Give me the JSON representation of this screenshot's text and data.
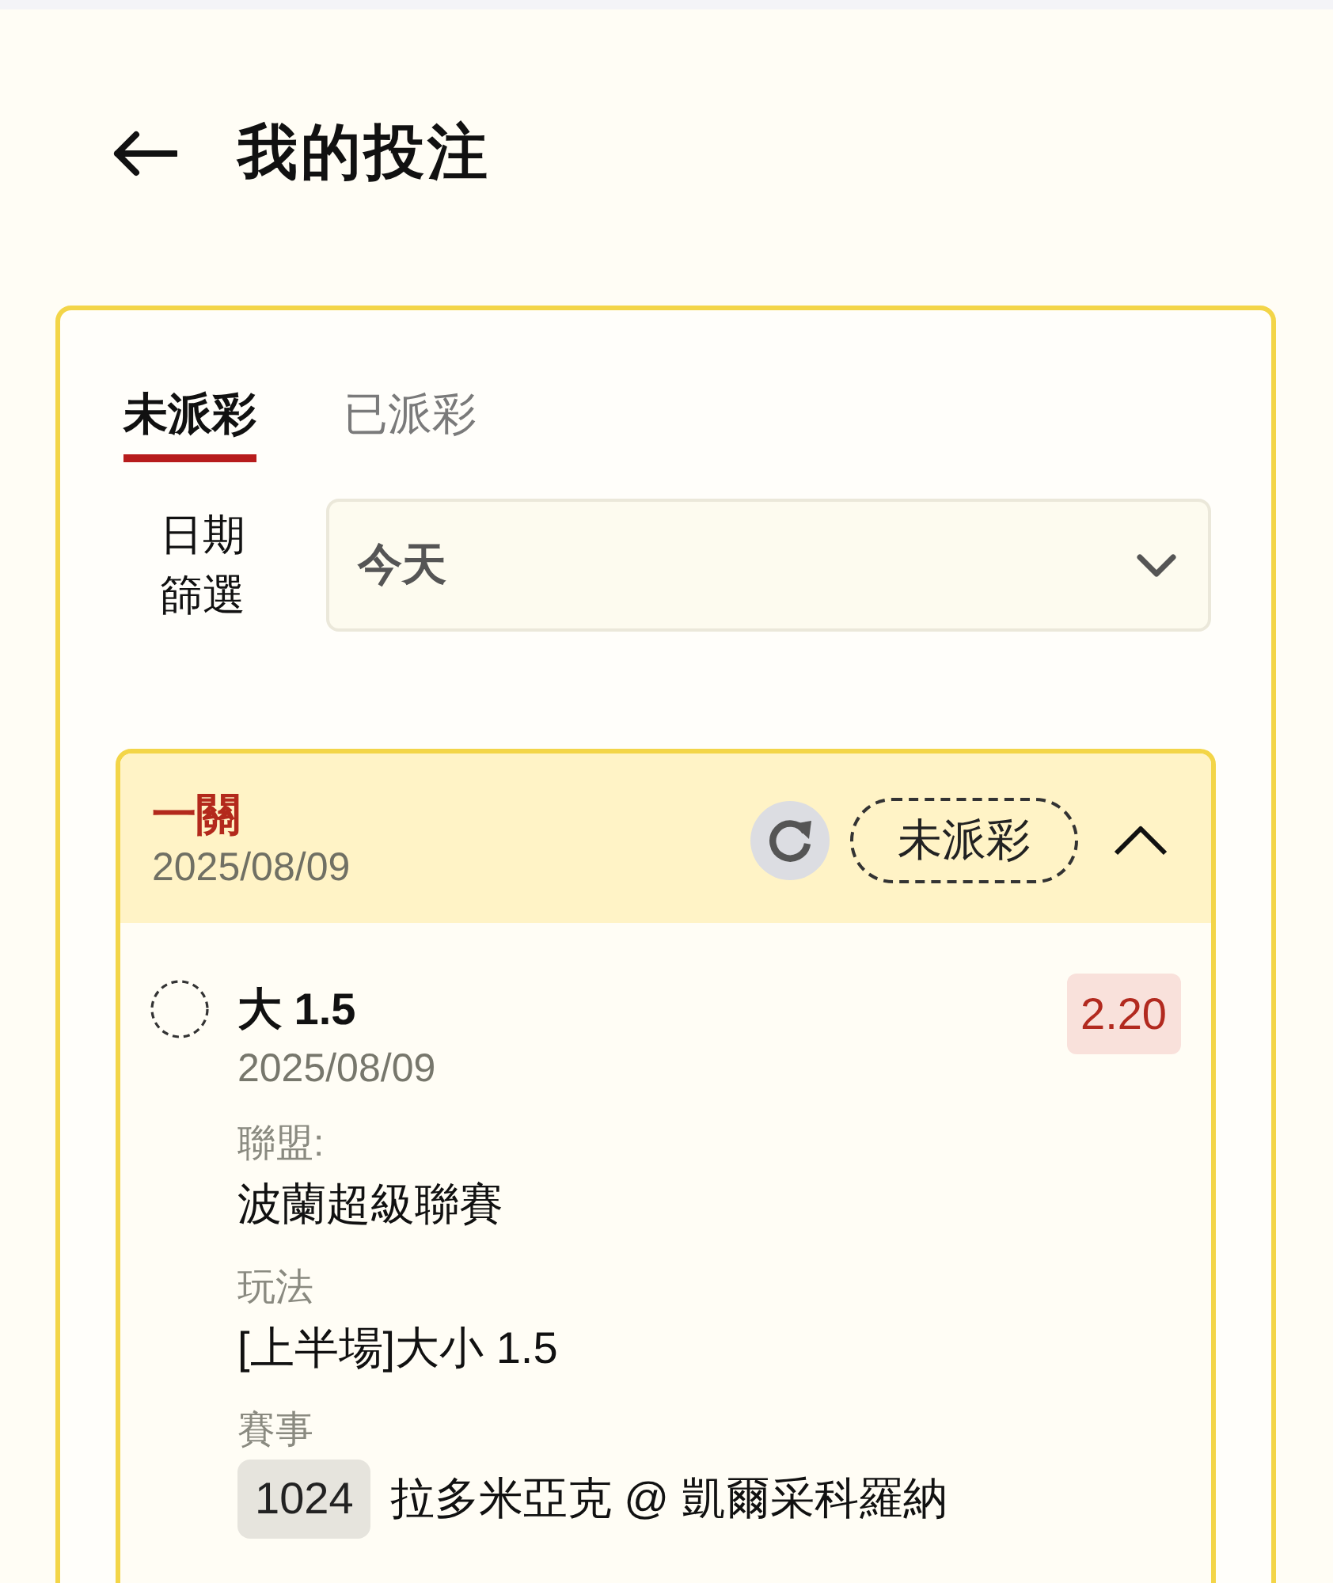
{
  "header": {
    "title": "我的投注"
  },
  "tabs": [
    {
      "label": "未派彩",
      "selected": true
    },
    {
      "label": "已派彩",
      "selected": false
    }
  ],
  "date_filter": {
    "label": "日期篩選",
    "value": "今天"
  },
  "bets": [
    {
      "type": "一關",
      "date": "2025/08/09",
      "status": "未派彩",
      "expanded": true,
      "selections": [
        {
          "pick": "大 1.5",
          "date": "2025/08/09",
          "odds": "2.20",
          "league": {
            "label": "聯盟:",
            "value": "波蘭超級聯賽"
          },
          "play": {
            "label": "玩法",
            "value": "[上半場]大小 1.5"
          },
          "match": {
            "label": "賽事",
            "number": "1024",
            "teams": "拉多米亞克 @ 凱爾采科羅納"
          }
        }
      ]
    }
  ]
}
